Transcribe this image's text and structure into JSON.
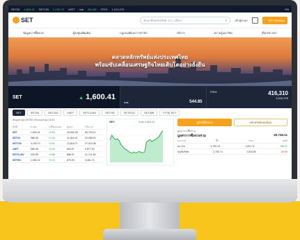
{
  "ticker": {
    "items": [
      "SET50",
      "1,600.41",
      "SET100",
      "2,193.70",
      "sSET",
      "mai",
      "544.85",
      "TFEX",
      "TFEX 416,310",
      "1,010,275",
      "EN"
    ]
  },
  "header": {
    "logo_text": "SET",
    "search_placeholder": "ค้นหาชื่อหลักทรัพย์, ข่าว, เนื้อหา",
    "login_label": "เข้าสู่ระบบ",
    "member_label": "SET Member"
  },
  "nav": {
    "items": [
      "ข้อมูลการซื้อขาย",
      "ผู้ลงทุนเพิ่มเติม",
      "กฎเกณฑ์และการกำกับ",
      "บริการ",
      "ความรู้และวิจัย",
      "เกี่ยวกับ SET"
    ]
  },
  "hero": {
    "line1": "ตลาดหลักทรัพย์แห่งประเทศไทย",
    "line2": "พร้อมขับเคลื่อนเศรษฐกิจไทยเติบโตอย่างยั่งยืน"
  },
  "indexbar": {
    "main_name": "SET",
    "main_value": "1,600.41",
    "main_arrow": "▲",
    "main_change": "+2.84 (+0.18%)",
    "mai_name": "mai",
    "mai_value": "544.85",
    "tfex_name": "TFEX",
    "tfex_value": "416,310",
    "tfex_sub": "1,010,275"
  },
  "tabs": [
    "SET",
    "SET50",
    "SET100",
    "sSET",
    "SETCLMV",
    "SETHD",
    "SETESG",
    "SETWB",
    "FTSE SET"
  ],
  "table": {
    "meta": "ข้อมูลล่าสุด  SET50  ปรับปรุงล่าสุด 16:43",
    "headers": [
      "ดัชนี",
      "ล่าสุด",
      "เปลี่ยนแปลง",
      "มูลค่า",
      "ปริมาณ"
    ],
    "rows": [
      [
        "SET",
        "1,600.41",
        "+2.84",
        "15,062.38",
        "66,793.21"
      ],
      [
        "SET50",
        "986.38",
        "+1.04",
        "11,042.29",
        "22,286.02"
      ],
      [
        "SET100",
        "2,193.70",
        "+3.91",
        "12,818.71",
        "27,019.36"
      ],
      [
        "sSET",
        "986.46",
        "+0.03",
        "804.97",
        "5,877.00"
      ],
      [
        "SETCLMV",
        "920.35",
        "+2.88",
        "886.97",
        "21,721.50"
      ],
      [
        "SETHD",
        "1,082.22",
        "+0.13",
        "879.09",
        "3,461.72"
      ]
    ]
  },
  "chart": {
    "title": "SET",
    "subtitle": "ล่าสุด 1,600.41"
  },
  "chart_data": {
    "type": "area",
    "x": [
      0,
      1,
      2,
      3,
      4,
      5,
      6,
      7,
      8,
      9,
      10,
      11,
      12,
      13,
      14,
      15,
      16,
      17,
      18,
      19,
      20,
      21,
      22,
      23,
      24,
      25,
      26,
      27,
      28,
      29
    ],
    "values": [
      1603,
      1604,
      1603.5,
      1603,
      1603.2,
      1602.8,
      1602,
      1601.5,
      1601,
      1600.8,
      1600.5,
      1600.2,
      1600,
      1600.3,
      1600.1,
      1600.2,
      1600.4,
      1600.2,
      1600.1,
      1600.3,
      1602.5,
      1602.8,
      1603,
      1602.6,
      1602.9,
      1603.1,
      1603.4,
      1603.8,
      1604.5,
      1605
    ],
    "ylim": [
      1598,
      1606
    ],
    "grid": true
  },
  "right_panel": {
    "tab_active": "ดูดัชนีทั้งหมด",
    "tab_other": "หลักทรัพย์ยอดนิยม",
    "label": "มูลค่าการซื้อขาย",
    "title": "มูลค่าการซื้อขายรวม",
    "title_value": "40,746.11",
    "rows": [
      [
        "ประเภท",
        "ซื้อ",
        "ขาย",
        "สุทธิ"
      ],
      [
        "สถาบัน",
        "3,780.18",
        "3,691.11",
        "+89.07"
      ],
      [
        "บัญชีบริษัท",
        "2,780.74",
        "2,810.80",
        "-30.06"
      ]
    ]
  }
}
